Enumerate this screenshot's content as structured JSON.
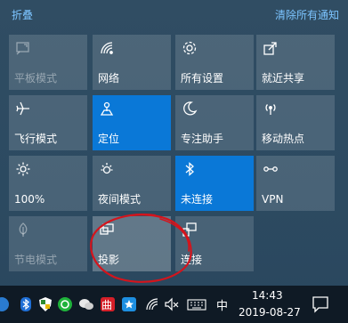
{
  "header": {
    "collapse": "折叠",
    "clear_all": "清除所有通知"
  },
  "tiles": {
    "tablet_mode": "平板模式",
    "network": "网络",
    "all_settings": "所有设置",
    "nearby_share": "就近共享",
    "airplane_mode": "飞行模式",
    "location": "定位",
    "focus_assist": "专注助手",
    "mobile_hotspot": "移动热点",
    "brightness": "100%",
    "night_light": "夜间模式",
    "bluetooth": "未连接",
    "vpn": "VPN",
    "battery_saver": "节电模式",
    "project": "投影",
    "connect": "连接"
  },
  "taskbar": {
    "ime": "中",
    "time": "14:43",
    "date": "2019-08-27",
    "app_red_label": "曲"
  },
  "colors": {
    "accent_tile": "#0a78d7",
    "link": "#7cc4ff",
    "annotation": "#d4141c"
  }
}
